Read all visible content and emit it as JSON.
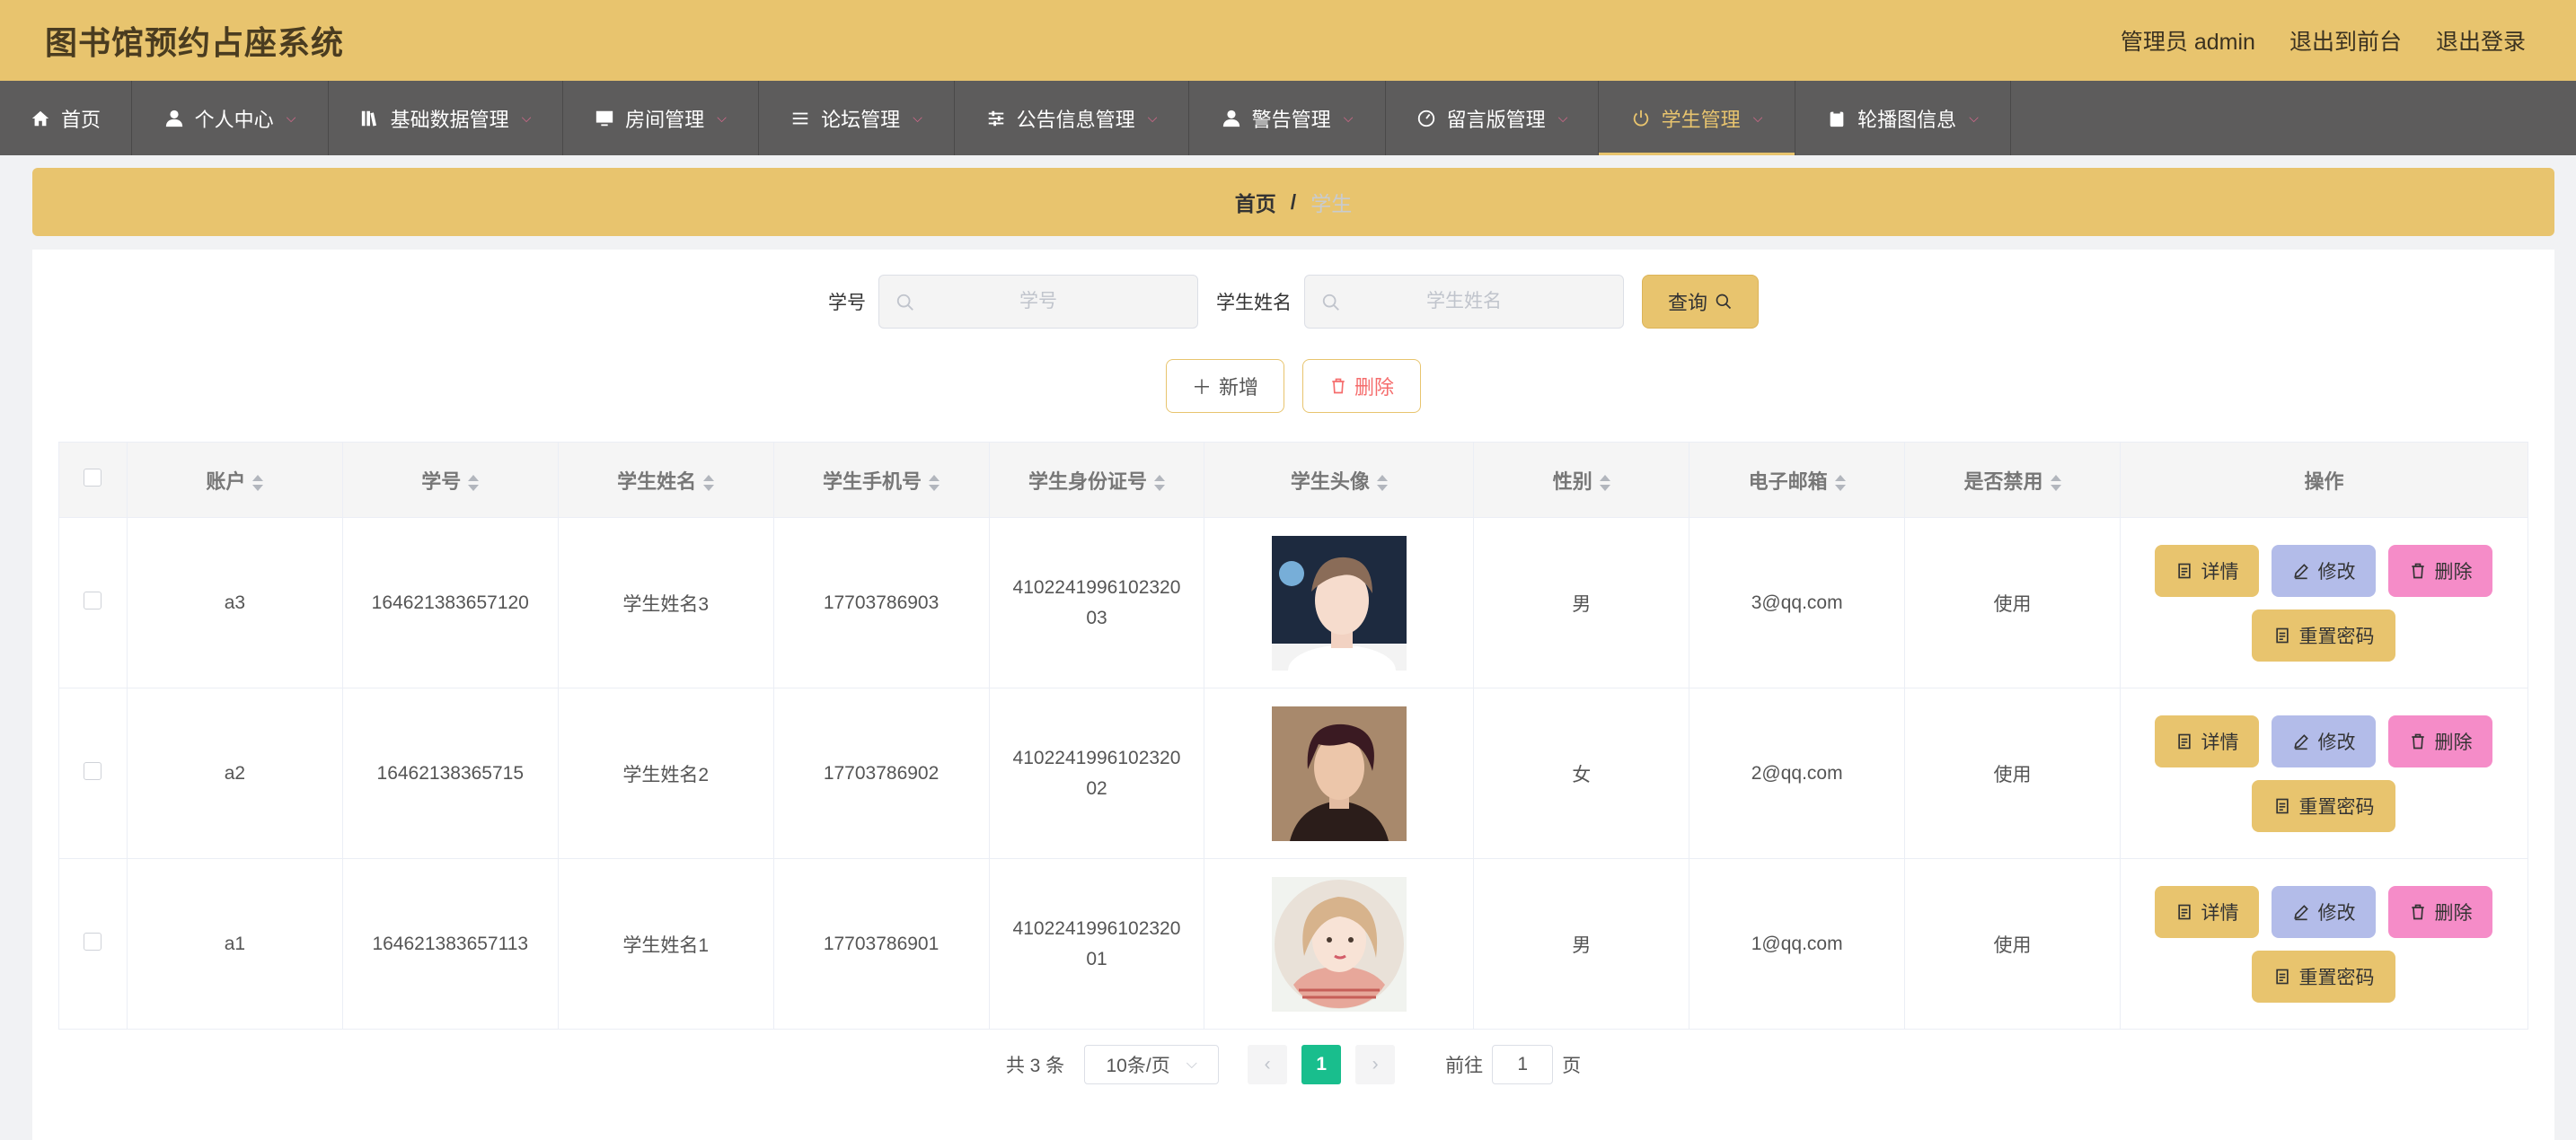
{
  "app": {
    "title": "图书馆预约占座系统",
    "user_label": "管理员 admin",
    "front_label": "退出到前台",
    "logout_label": "退出登录"
  },
  "nav": [
    {
      "label": "首页",
      "icon": "home-icon",
      "dropdown": false,
      "active": false
    },
    {
      "label": "个人中心",
      "icon": "user-icon",
      "dropdown": true,
      "active": false
    },
    {
      "label": "基础数据管理",
      "icon": "books-icon",
      "dropdown": true,
      "active": false
    },
    {
      "label": "房间管理",
      "icon": "monitor-icon",
      "dropdown": true,
      "active": false
    },
    {
      "label": "论坛管理",
      "icon": "list-icon",
      "dropdown": true,
      "active": false
    },
    {
      "label": "公告信息管理",
      "icon": "sliders-icon",
      "dropdown": true,
      "active": false
    },
    {
      "label": "警告管理",
      "icon": "user-icon",
      "dropdown": true,
      "active": false
    },
    {
      "label": "留言版管理",
      "icon": "gauge-icon",
      "dropdown": true,
      "active": false
    },
    {
      "label": "学生管理",
      "icon": "power-icon",
      "dropdown": true,
      "active": true
    },
    {
      "label": "轮播图信息",
      "icon": "clipboard-icon",
      "dropdown": true,
      "active": false
    }
  ],
  "breadcrumb": {
    "home": "首页",
    "separator": "/",
    "current": "学生"
  },
  "search": {
    "id_label": "学号",
    "id_placeholder": "学号",
    "name_label": "学生姓名",
    "name_placeholder": "学生姓名",
    "query_label": "查询"
  },
  "actions": {
    "add_label": "新增",
    "delete_label": "删除"
  },
  "table": {
    "headers": [
      "账户",
      "学号",
      "学生姓名",
      "学生手机号",
      "学生身份证号",
      "学生头像",
      "性别",
      "电子邮箱",
      "是否禁用",
      "操作"
    ],
    "rows": [
      {
        "account": "a3",
        "student_id": "164621383657120",
        "name": "学生姓名3",
        "phone": "17703786903",
        "id_card_1": "4102241996102320",
        "id_card_2": "03",
        "avatar": "avatar-boy-blue",
        "gender": "男",
        "email": "3@qq.com",
        "disabled": "使用"
      },
      {
        "account": "a2",
        "student_id": "16462138365715",
        "name": "学生姓名2",
        "phone": "17703786902",
        "id_card_1": "4102241996102320",
        "id_card_2": "02",
        "avatar": "avatar-boy-dark",
        "gender": "女",
        "email": "2@qq.com",
        "disabled": "使用"
      },
      {
        "account": "a1",
        "student_id": "164621383657113",
        "name": "学生姓名1",
        "phone": "17703786901",
        "id_card_1": "4102241996102320",
        "id_card_2": "01",
        "avatar": "avatar-girl-sketch",
        "gender": "男",
        "email": "1@qq.com",
        "disabled": "使用"
      }
    ],
    "row_actions": {
      "detail": "详情",
      "edit": "修改",
      "delete": "删除",
      "reset": "重置密码"
    }
  },
  "pagination": {
    "total": "共 3 条",
    "page_size": "10条/页",
    "current_page": "1",
    "goto_prefix": "前往",
    "goto_value": "1",
    "goto_suffix": "页"
  },
  "colors": {
    "header_bg": "#e8c46e",
    "nav_bg": "#5d5c5c",
    "accent": "#e8c46e",
    "edit_btn": "#b3bce9",
    "delete_btn": "#f58cc8",
    "page_active": "#19be8d",
    "danger": "#f56c6c"
  }
}
